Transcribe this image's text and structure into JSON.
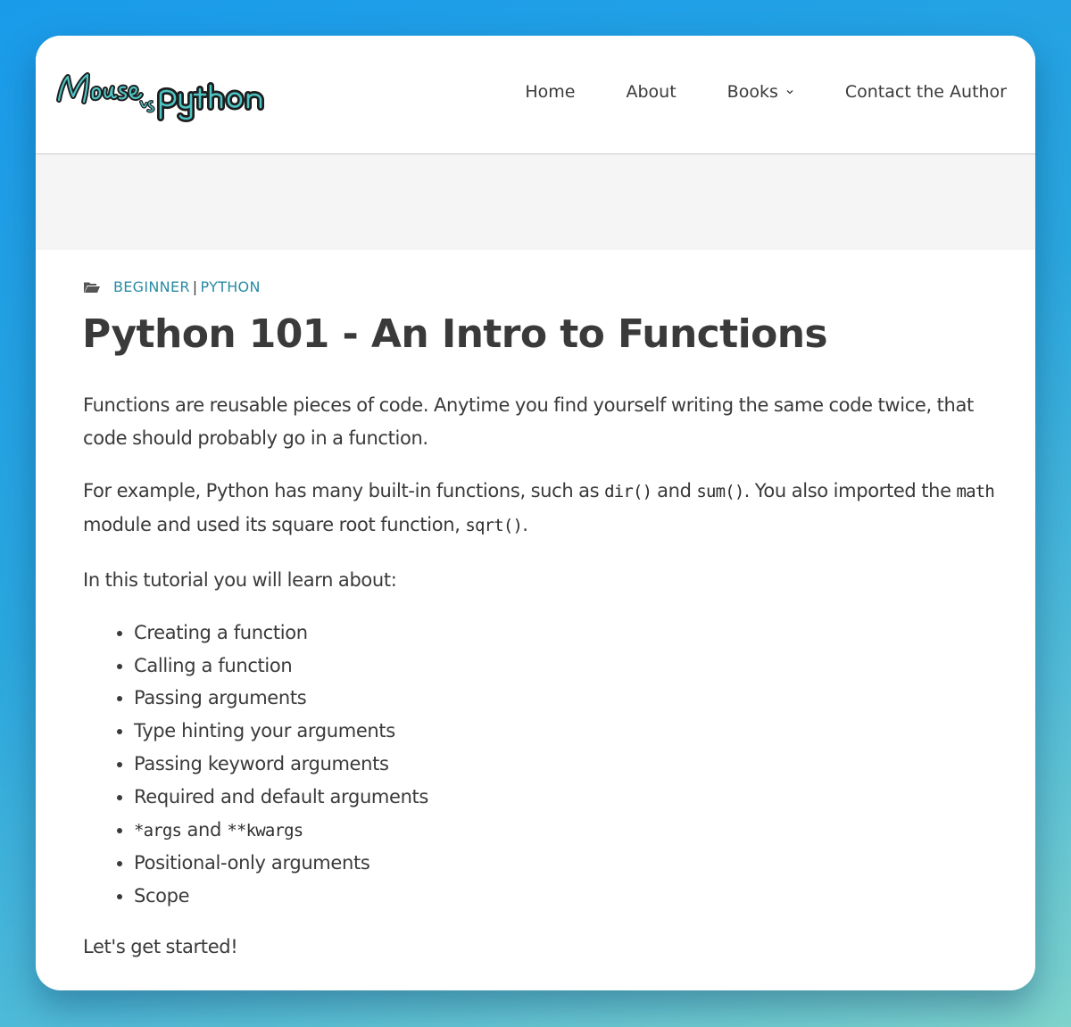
{
  "header": {
    "logo_text": "Mouse vs Python",
    "nav": [
      {
        "label": "Home"
      },
      {
        "label": "About"
      },
      {
        "label": "Books"
      },
      {
        "label": "Contact the Author"
      }
    ]
  },
  "post": {
    "categories": [
      "BEGINNER",
      "PYTHON"
    ],
    "title": "Python 101 - An Intro to Functions",
    "p1": "Functions are reusable pieces of code. Anytime you find yourself writing the same code twice, that code should probably go in a function.",
    "p2": {
      "t1": "For example, Python has many built-in functions, such as ",
      "c1": "dir()",
      "t2": " and ",
      "c2": "sum()",
      "t3": ". You also imported the ",
      "c3": "math",
      "t4": " module and used its square root function, ",
      "c4": "sqrt()",
      "t5": "."
    },
    "p3": "In this tutorial you will learn about:",
    "list": {
      "i1": "Creating a function",
      "i2": "Calling a function",
      "i3": "Passing arguments",
      "i4": "Type hinting your arguments",
      "i5": "Passing keyword arguments",
      "i6": "Required and default arguments",
      "i7_code1": "*args",
      "i7_text": " and ",
      "i7_code2": "**kwargs",
      "i8": "Positional-only arguments",
      "i9": "Scope"
    },
    "p4": "Let's get started!"
  },
  "colors": {
    "link": "#2a8ba3",
    "text": "#3a3a3a",
    "band": "#f5f5f5"
  }
}
